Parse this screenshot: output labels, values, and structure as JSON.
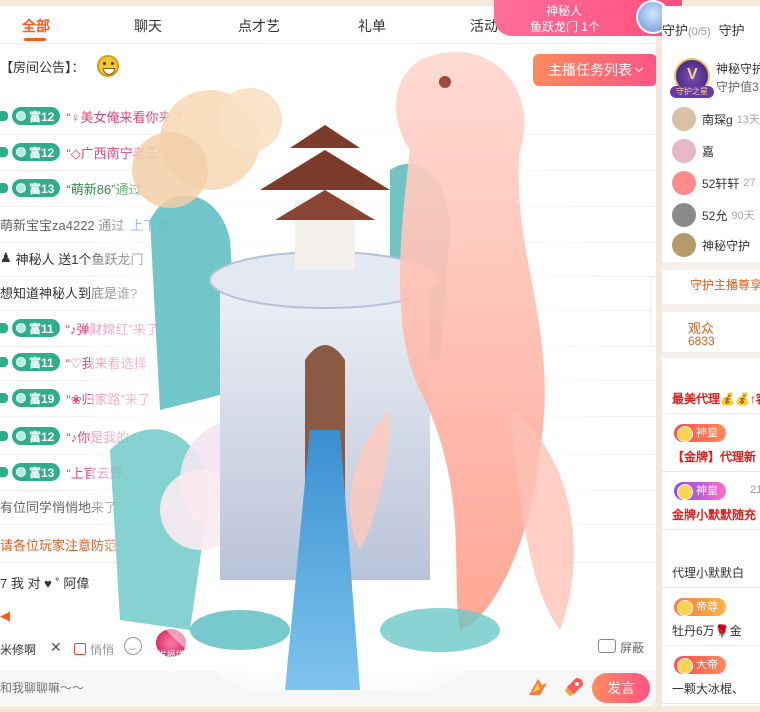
{
  "tabs": [
    "全部",
    "聊天",
    "点才艺",
    "礼单",
    "活动"
  ],
  "announcement": {
    "label": "【房间公告】："
  },
  "task_button": {
    "label": "主播任务列表"
  },
  "mystery": {
    "name": "神秘人",
    "gift": "鱼跃龙门 1个"
  },
  "messages": [
    {
      "level": "富12",
      "text": "“♀美女俺来看你来了”"
    },
    {
      "level": "富12",
      "text": "“◇广西南宁老王”"
    },
    {
      "level": "富13",
      "text": "“萌新86”通过"
    },
    {
      "level": "",
      "text": "萌新宝宝za4222 通过",
      "suffix": "上下滑"
    },
    {
      "level": "",
      "text": "神秘人 送1个鱼跃龙门"
    },
    {
      "level": "",
      "text": "想知道神秘人到底是谁?"
    },
    {
      "level": "富11",
      "text": "“♪弹财嫦红”来了"
    },
    {
      "level": "富11",
      "text": "“♡我来看选择"
    },
    {
      "level": "富19",
      "text": "“❀归家路”来了"
    },
    {
      "level": "富12",
      "text": "“♪你是我的"
    },
    {
      "level": "富13",
      "text": "“上官云野"
    },
    {
      "level": "",
      "text": "有位同学悄悄地来了"
    },
    {
      "level": "",
      "text": "请各位玩家注意防范"
    },
    {
      "level": "",
      "text": "7 我 对 ♥ ˚ 阿偉"
    }
  ],
  "bottom": {
    "name_chip": "米修啊",
    "anon_label": "悄悄",
    "lucky_label": "发福袋",
    "block_label": "屏蔽",
    "input_placeholder": "和我聊聊嘛～～",
    "send_label": "发言",
    "fly_label": "飘风"
  },
  "sidebar": {
    "guard_tab": "守护",
    "guard_count": "(0/5)",
    "guard_tab2": "守护",
    "guard_badge_label": "守护之星",
    "mystery_guard_title": "神秘守护",
    "mystery_guard_value": "守护值3",
    "guards": [
      {
        "name": "南琛g",
        "date": "13天"
      },
      {
        "name": "嘉",
        "date": ""
      },
      {
        "name": "52轩轩",
        "date": "27"
      },
      {
        "name": "52允",
        "date": "90天"
      },
      {
        "name": "神秘守护",
        "date": ""
      }
    ],
    "guard_link": "守护主播尊享",
    "audience_label": "观众",
    "audience_count": "6833",
    "audience": [
      {
        "tag": "",
        "name": "最美代理💰💰↑客"
      },
      {
        "tag": "神皇",
        "name": "【金牌】代理新"
      },
      {
        "tag": "神皇",
        "name": "金牌小默默随充",
        "extra": "21"
      },
      {
        "tag": "",
        "name": "代理小默默白"
      },
      {
        "tag": "帝尊",
        "name": "牡丹6万🌹金"
      },
      {
        "tag": "大帝",
        "name": "一颗大冰棍、"
      }
    ]
  },
  "colors": {
    "accent": "#ff5a1e",
    "brand_pink": "#ff5486",
    "level_green": "#2fae8a"
  }
}
